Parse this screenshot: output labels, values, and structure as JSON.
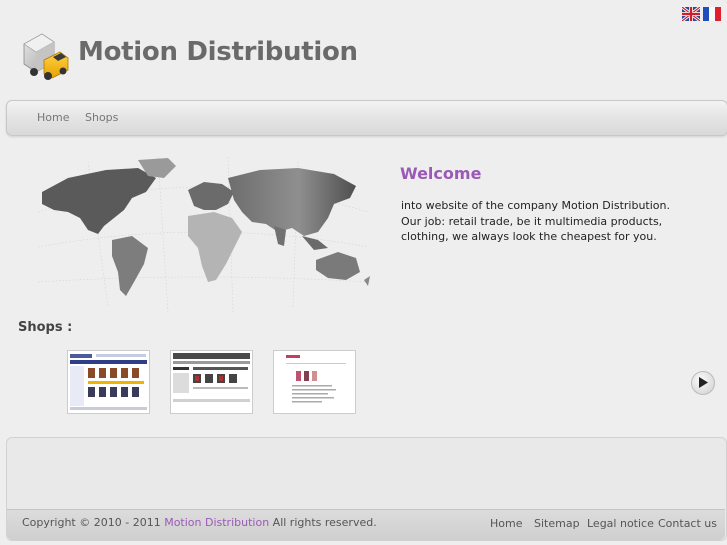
{
  "header": {
    "title": "Motion Distribution",
    "languages": [
      {
        "code": "en",
        "icon": "uk-flag-icon"
      },
      {
        "code": "fr",
        "icon": "france-flag-icon"
      }
    ]
  },
  "nav": {
    "items": [
      "Home",
      "Shops"
    ]
  },
  "welcome": {
    "title": "Welcome",
    "lines": [
      "into website of the company Motion Distribution.",
      "Our job: retail trade, be it multimedia products, clothing, we always look the cheapest for you."
    ]
  },
  "shops": {
    "title": "Shops :"
  },
  "footer": {
    "copyright_prefix": "Copyright © 2010 - 2011 ",
    "brand": "Motion Distribution",
    "copyright_suffix": " All rights reserved.",
    "links": [
      "Home",
      "Sitemap",
      "Legal notice",
      "Contact us"
    ]
  },
  "colors": {
    "accent": "#9b59b6",
    "title": "#6a6a6a"
  }
}
